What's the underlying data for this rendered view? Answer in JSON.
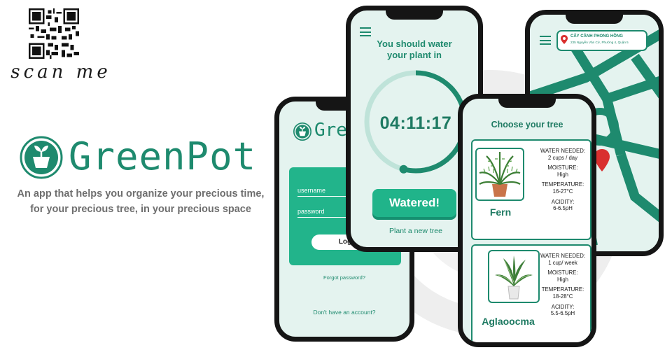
{
  "promo": {
    "scan_label": "scan me",
    "brand_name": "GreenPot",
    "tagline_line1": "An app that helps you organize your precious time,",
    "tagline_line2": "for your precious tree, in your precious space"
  },
  "login_screen": {
    "logo_text": "Gree",
    "username_label": "username",
    "password_label": "password",
    "login_button_label": "Log",
    "forgot_password": "Forgot password?",
    "signup_prompt": "Don't have an account?"
  },
  "timer_screen": {
    "title_line1": "You should water",
    "title_line2": "your plant in",
    "countdown": "04:11:17",
    "progress_fraction": 0.54,
    "watered_button": "Watered!",
    "plant_new_link": "Plant a new tree"
  },
  "map_screen": {
    "place_name": "CÂY CẢNH PHONG HỒNG",
    "place_address": "235 Nguyễn Văn Cừ, Phường 4, Quận 5"
  },
  "tree_screen": {
    "title": "Choose your tree",
    "trees": [
      {
        "name": "Fern",
        "water_label": "WATER NEEDED:",
        "water_value": "2 cups / day",
        "moisture_label": "MOISTURE:",
        "moisture_value": "High",
        "temperature_label": "TEMPERATURE:",
        "temperature_value": "16-27°C",
        "acidity_label": "ACIDITY:",
        "acidity_value": "6-6.5pH"
      },
      {
        "name": "Aglaoocma",
        "water_label": "WATER NEEDED:",
        "water_value": "1 cup/ week",
        "moisture_label": "MOISTURE:",
        "moisture_value": "High",
        "temperature_label": "TEMPERATURE:",
        "temperature_value": "18-28°C",
        "acidity_label": "ACIDITY:",
        "acidity_value": "5.5-6.5pH"
      }
    ]
  },
  "colors": {
    "brand_green": "#1e8a6e",
    "button_green": "#20b48a",
    "screen_bg": "#e4f3ef",
    "map_pin": "#d9302f"
  },
  "icons": [
    "qr-code",
    "plant-pot-logo",
    "hamburger-menu",
    "location-pin"
  ]
}
